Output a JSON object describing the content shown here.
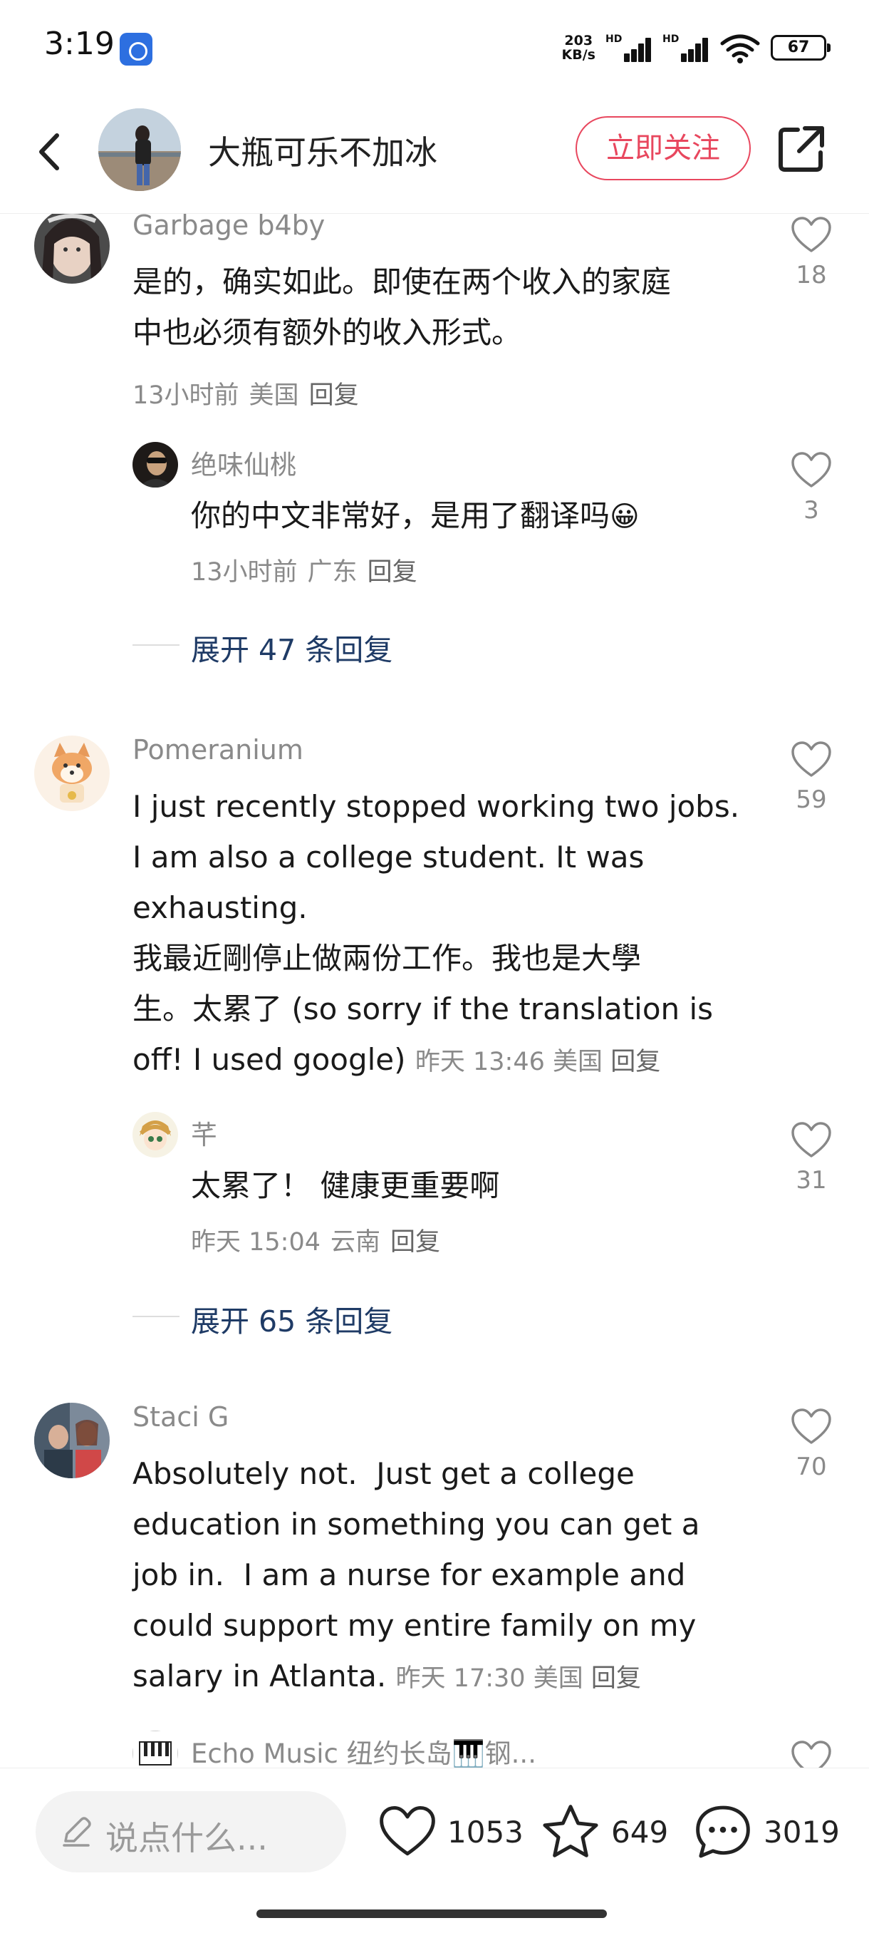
{
  "status_bar": {
    "time": "3:19",
    "net_speed_value": "203",
    "net_speed_unit": "KB/s",
    "signal_label": "HD",
    "battery": "67"
  },
  "header": {
    "name": "大瓶可乐不加冰",
    "follow_label": "立即关注"
  },
  "comments": [
    {
      "username": "Garbage b4by",
      "text_lines": [
        "是的，确实如此。即使在两个收入的家庭",
        "中也必须有额外的收入形式。"
      ],
      "meta": {
        "time": "13小时前",
        "location": "美国",
        "reply": "回复"
      },
      "likes": "18",
      "reply": {
        "username": "绝味仙桃",
        "text": "你的中文非常好，是用了翻译吗",
        "emoji": "😀",
        "meta": {
          "time": "13小时前",
          "location": "广东",
          "reply": "回复"
        },
        "likes": "3"
      },
      "expand_label": "展开 47 条回复"
    },
    {
      "username": "Pomeranium",
      "text_lines": [
        "I just recently stopped working two jobs.",
        "I am also a college student. It was",
        "exhausting.",
        "我最近剛停止做兩份工作。我也是大學",
        "生。太累了 (so sorry if the translation is",
        "off! I used google)"
      ],
      "meta": {
        "time": "昨天 13:46",
        "location": "美国",
        "reply": "回复"
      },
      "likes": "59",
      "reply": {
        "username": "芊",
        "text": "太累了！ 健康更重要啊",
        "meta": {
          "time": "昨天 15:04",
          "location": "云南",
          "reply": "回复"
        },
        "likes": "31"
      },
      "expand_label": "展开 65 条回复"
    },
    {
      "username": "Staci G",
      "text_lines": [
        "Absolutely not.  Just get a college",
        "education in something you can get a",
        "job in.  I am a nurse for example and",
        "could support my entire family on my",
        "salary in Atlanta."
      ],
      "meta": {
        "time": "昨天 17:30",
        "location": "美国",
        "reply": "回复"
      },
      "likes": "70",
      "reply": {
        "username": "Echo Music 纽约长岛🎹钢..."
      }
    }
  ],
  "bottom_bar": {
    "placeholder": "说点什么...",
    "likes": "1053",
    "favorites": "649",
    "comments": "3019"
  }
}
